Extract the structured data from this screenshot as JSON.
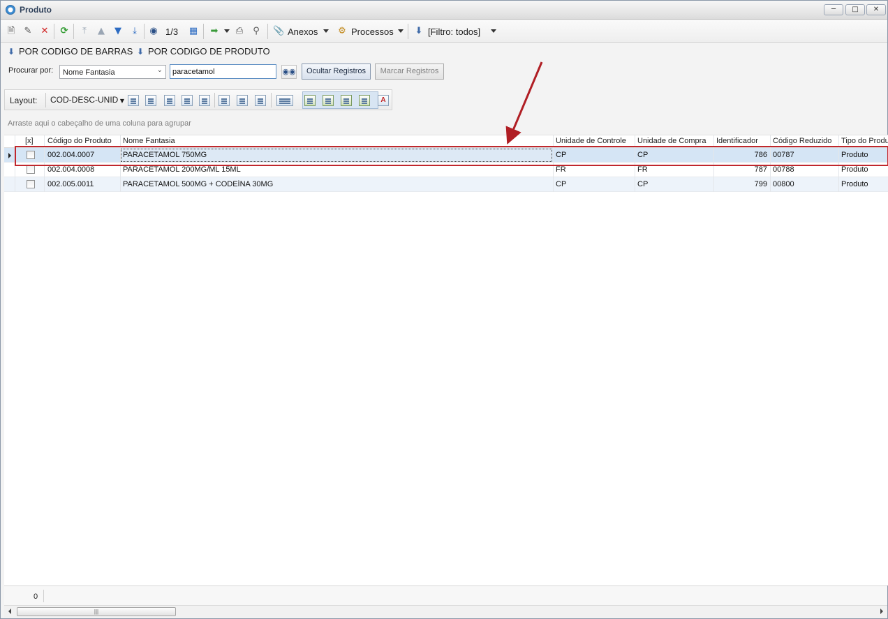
{
  "window": {
    "title": "Produto"
  },
  "toolbar": {
    "record_position": "1/3",
    "attachments_label": "Anexos",
    "processes_label": "Processos",
    "filter_label": "[Filtro: todos]"
  },
  "quick": {
    "by_barcode": "POR CODIGO DE BARRAS",
    "by_product_code": "POR CODIGO DE PRODUTO"
  },
  "search": {
    "label": "Procurar por:",
    "field": "Nome Fantasia",
    "value": "paracetamol",
    "hide_button": "Ocultar Registros",
    "mark_button": "Marcar Registros"
  },
  "layoutbar": {
    "label": "Layout:",
    "layout_name": "COD-DESC-UNID"
  },
  "group": {
    "hint": "Arraste aqui o cabeçalho de uma coluna para agrupar"
  },
  "grid": {
    "columns": [
      "[x]",
      "Código do Produto",
      "Nome Fantasia",
      "Unidade de Controle",
      "Unidade de Compra",
      "Identificador",
      "Código Reduzido",
      "Tipo do Produ"
    ],
    "rows": [
      {
        "codigo": "002.004.0007",
        "nome": "PARACETAMOL 750MG",
        "un_controle": "CP",
        "un_compra": "CP",
        "identificador": "786",
        "cod_reduzido": "00787",
        "tipo": "Produto",
        "checked": false
      },
      {
        "codigo": "002.004.0008",
        "nome": "PARACETAMOL 200MG/ML 15ML",
        "un_controle": "FR",
        "un_compra": "FR",
        "identificador": "787",
        "cod_reduzido": "00788",
        "tipo": "Produto",
        "checked": false
      },
      {
        "codigo": "002.005.0011",
        "nome": "PARACETAMOL 500MG + CODEÍNA 30MG",
        "un_controle": "CP",
        "un_compra": "CP",
        "identificador": "799",
        "cod_reduzido": "00800",
        "tipo": "Produto",
        "checked": false
      }
    ]
  },
  "footer": {
    "count": "0"
  },
  "colors": {
    "highlight": "#c0272d",
    "selected_row": "#d5e5f5",
    "alt_row": "#edf3fa"
  }
}
